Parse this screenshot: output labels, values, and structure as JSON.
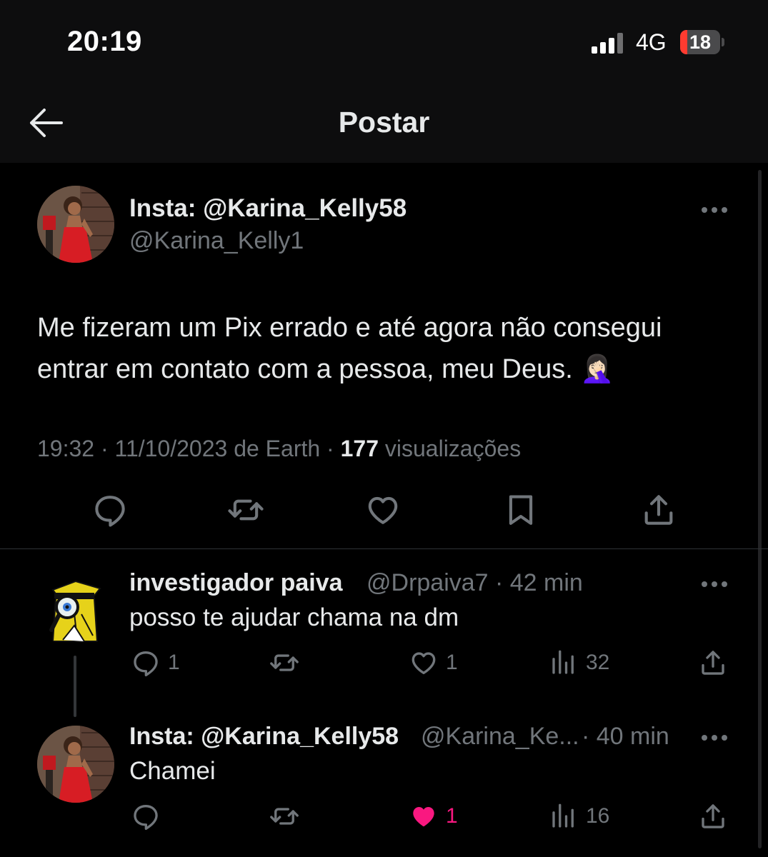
{
  "status_bar": {
    "time": "20:19",
    "network": "4G",
    "battery": "18",
    "battery_level": 0.18,
    "signal_icon": "cellular-signal-icon",
    "battery_icon": "battery-icon"
  },
  "header": {
    "title": "Postar",
    "back_icon": "arrow-left-icon"
  },
  "post": {
    "display_name": "Insta: @Karina_Kelly58",
    "handle": "@Karina_Kelly1",
    "text": "Me fizeram um Pix errado e até agora não consegui entrar em contato com a pessoa, meu Deus. 🤦🏻‍♀️",
    "time": "19:32",
    "date": "11/10/2023 de Earth",
    "views_count": "177",
    "views_label": "visualizações",
    "actions": [
      "reply-icon",
      "repost-icon",
      "like-icon",
      "bookmark-icon",
      "share-icon"
    ]
  },
  "replies": [
    {
      "display_name": "investigador paiva",
      "handle": "@Drpaiva7",
      "time": "· 42 min",
      "text": "posso te ajudar chama na dm",
      "reply_count": "1",
      "repost_count": "",
      "like_count": "1",
      "views_count": "32",
      "liked": false
    },
    {
      "display_name": "Insta: @Karina_Kelly58",
      "handle": "@Karina_Ke...",
      "time": "· 40 min",
      "text": "Chamei",
      "reply_count": "",
      "repost_count": "",
      "like_count": "1",
      "views_count": "16",
      "liked": true
    }
  ],
  "colors": {
    "background": "#000000",
    "header_bg": "#0d0d0e",
    "text_primary": "#e7e9ea",
    "text_secondary": "#71767b",
    "like_active": "#f91880",
    "battery_low": "#ff3b30"
  }
}
